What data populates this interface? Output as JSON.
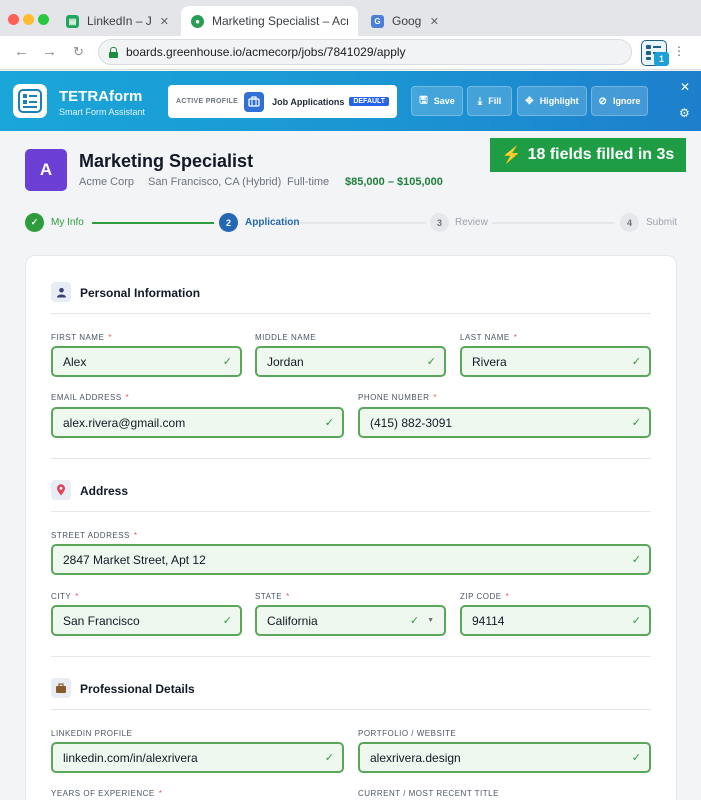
{
  "browser": {
    "tabs": [
      {
        "label": "LinkedIn – Jobs",
        "icon": "linkedin-icon",
        "close": "✕"
      },
      {
        "label": "Marketing Specialist – Acme Corp",
        "icon": "greenhouse-icon",
        "close": "✕"
      },
      {
        "label": "Google",
        "icon": "google-icon",
        "close": "✕"
      }
    ],
    "url": "boards.greenhouse.io/acmecorp/jobs/7841029/apply",
    "extension_badge": "1"
  },
  "extension": {
    "name": "TETRAform",
    "subtitle": "Smart Form Assistant",
    "profile_label": "ACTIVE PROFILE",
    "profile_name": "Job Applications",
    "profile_badge": "DEFAULT",
    "buttons": {
      "save": "Save",
      "fill": "Fill",
      "highlight": "Highlight",
      "ignore": "Ignore"
    }
  },
  "job": {
    "avatar_letter": "A",
    "title": "Marketing Specialist",
    "company": "Acme Corp",
    "location": "San Francisco, CA (Hybrid)",
    "type": "Full-time",
    "salary": "$85,000 – $105,000"
  },
  "fill_status": "18 fields filled in 3s",
  "steps": [
    {
      "num": "✓",
      "label": "My Info",
      "state": "done"
    },
    {
      "num": "2",
      "label": "Application",
      "state": "active"
    },
    {
      "num": "3",
      "label": "Review",
      "state": "todo"
    },
    {
      "num": "4",
      "label": "Submit",
      "state": "todo"
    }
  ],
  "form": {
    "personal": {
      "title": "Personal Information",
      "first_name_label": "FIRST NAME",
      "first_name": "Alex",
      "middle_name_label": "MIDDLE NAME",
      "middle_name": "Jordan",
      "last_name_label": "LAST NAME",
      "last_name": "Rivera",
      "email_label": "EMAIL ADDRESS",
      "email": "alex.rivera@gmail.com",
      "phone_label": "PHONE NUMBER",
      "phone": "(415) 882-3091"
    },
    "address": {
      "title": "Address",
      "street_label": "STREET ADDRESS",
      "street": "2847 Market Street, Apt 12",
      "city_label": "CITY",
      "city": "San Francisco",
      "state_label": "STATE",
      "state": "California",
      "zip_label": "ZIP CODE",
      "zip": "94114"
    },
    "professional": {
      "title": "Professional Details",
      "linkedin_label": "LINKEDIN PROFILE",
      "linkedin": "linkedin.com/in/alexrivera",
      "portfolio_label": "PORTFOLIO / WEBSITE",
      "portfolio": "alexrivera.design",
      "years_label": "YEARS OF EXPERIENCE",
      "current_title_label": "CURRENT / MOST RECENT TITLE"
    },
    "required_mark": "*",
    "check_mark": "✓"
  },
  "colors": {
    "brand": "#1b97d4",
    "success": "#1f9d44",
    "field_border": "#5aa65a",
    "field_bg": "#eef8ee",
    "avatar": "#6b3fd4"
  }
}
